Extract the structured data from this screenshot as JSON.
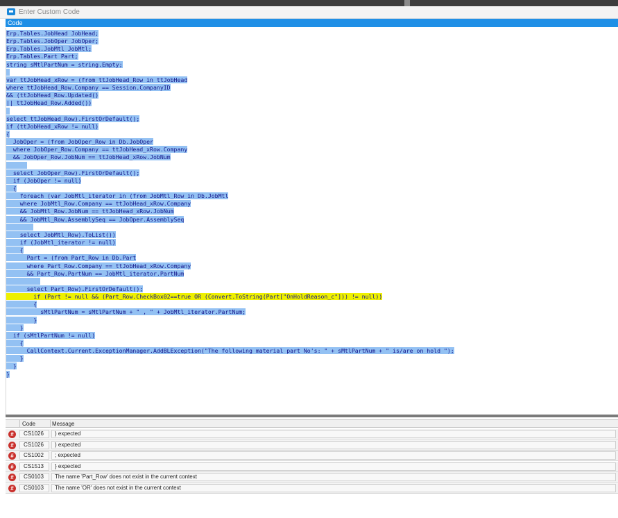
{
  "window": {
    "title": "Enter Custom Code"
  },
  "editor": {
    "header": "Code",
    "lines": [
      "Erp.Tables.JobHead JobHead;",
      "Erp.Tables.JobOper JobOper;",
      "Erp.Tables.JobMtl JobMtl;",
      "Erp.Tables.Part Part;",
      "string sMtlPartNum = string.Empty;",
      " ",
      "var ttJobHead_xRow = (from ttJobHead_Row in ttJobHead",
      "where ttJobHead_Row.Company == Session.CompanyID",
      "&& (ttJobHead_Row.Updated()",
      "|| ttJobHead_Row.Added())",
      " ",
      "select ttJobHead_Row).FirstOrDefault();",
      "if (ttJobHead_xRow != null)",
      "{",
      "  JobOper = (from JobOper_Row in Db.JobOper",
      "  where JobOper_Row.Company == ttJobHead_xRow.Company",
      "  && JobOper_Row.JobNum == ttJobHead_xRow.JobNum",
      "      ",
      "  select JobOper_Row).FirstOrDefault();",
      "  if (JobOper != null)",
      "  {",
      "    foreach (var JobMtl_iterator in (from JobMtl_Row in Db.JobMtl",
      "    where JobMtl_Row.Company == ttJobHead_xRow.Company",
      "    && JobMtl_Row.JobNum == ttJobHead_xRow.JobNum",
      "    && JobMtl_Row.AssemblySeq == JobOper.AssemblySeq",
      "        ",
      "    select JobMtl_Row).ToList())",
      "    if (JobMtl_iterator != null)",
      "    {",
      "      Part = (from Part_Row in Db.Part",
      "      where Part_Row.Company == ttJobHead_xRow.Company",
      "      && Part_Row.PartNum == JobMtl_iterator.PartNum",
      "          ",
      "      select Part_Row).FirstOrDefault();",
      "        if (Part != null && (Part_Row.CheckBox02==true OR (Convert.ToString(Part[\"OnHoldReason_c\"])) != null))",
      "        {",
      "          sMtlPartNum = sMtlPartNum + \" , \" + JobMtl_iterator.PartNum;",
      "        }",
      "    }",
      "  if (sMtlPartNum != null)",
      "    {",
      "      CallContext.Current.ExceptionManager.AddBLException(\"The following material part No's: \" + sMtlPartNum + \" is/are on hold \");",
      "    }",
      "  }",
      "}"
    ]
  },
  "errors": {
    "columns": {
      "code": "Code",
      "message": "Message"
    },
    "rows": [
      {
        "code": "CS1026",
        "message": ") expected"
      },
      {
        "code": "CS1026",
        "message": ") expected"
      },
      {
        "code": "CS1002",
        "message": "; expected"
      },
      {
        "code": "CS1513",
        "message": "} expected"
      },
      {
        "code": "CS0103",
        "message": "The name 'Part_Row' does not exist in the current context"
      },
      {
        "code": "CS0103",
        "message": "The name 'OR' does not exist in the current context"
      }
    ]
  },
  "colors": {
    "accent": "#1f8fe6",
    "selection": "#93c1f3",
    "highlight": "#eef000",
    "code_text": "#15158a",
    "error_icon": "#c9302c"
  }
}
